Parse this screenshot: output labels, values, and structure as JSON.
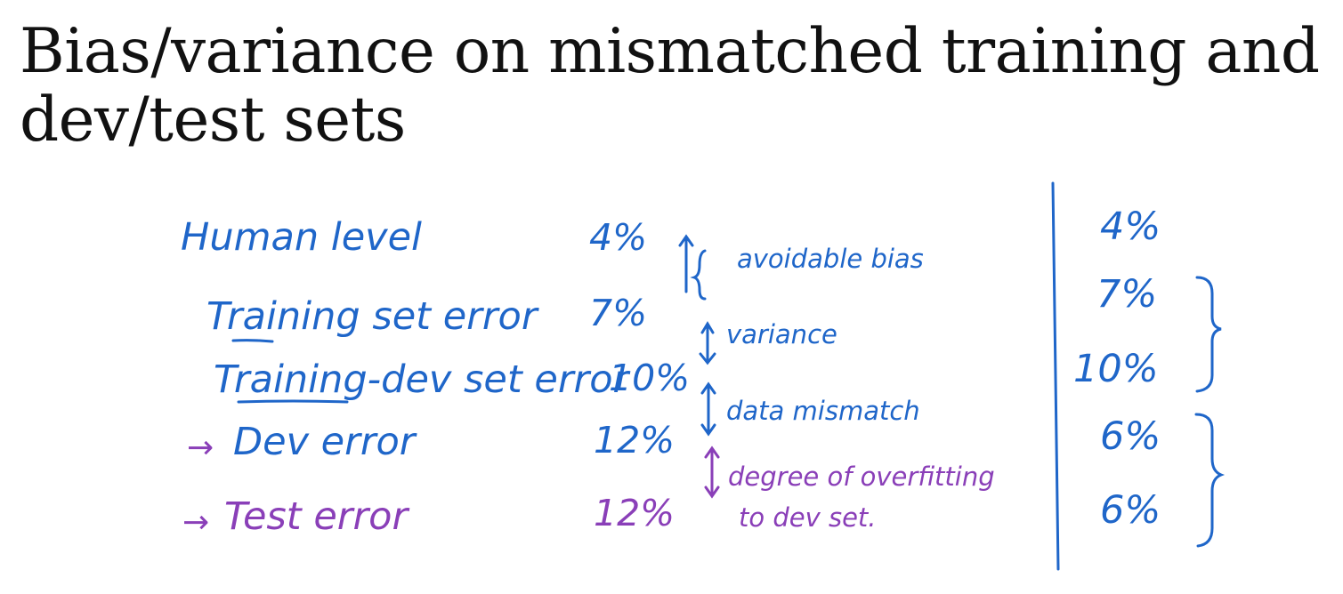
{
  "slide": {
    "title_line1": "Bias/variance on mismatched training and",
    "title_line2": "dev/test sets"
  },
  "handwriting": {
    "rows": [
      {
        "label": "Human level",
        "value": "4%"
      },
      {
        "label": "Training set error",
        "value": "7%"
      },
      {
        "label": "Training-dev set error",
        "value": "10%"
      },
      {
        "label": "Dev error",
        "value": "12%",
        "marker": "→"
      },
      {
        "label": "Test error",
        "value": "12%",
        "marker": "→"
      }
    ],
    "gaps": [
      {
        "text": "avoidable bias"
      },
      {
        "text": "variance"
      },
      {
        "text": "data mismatch"
      },
      {
        "text": "degree of overfitting",
        "text2": "to dev set."
      }
    ],
    "right_values": [
      "4%",
      "7%",
      "10%",
      "6%",
      "6%"
    ],
    "colors": {
      "blue": "#1f66c9",
      "purple": "#8a3fb8",
      "ink": "#111111"
    }
  }
}
